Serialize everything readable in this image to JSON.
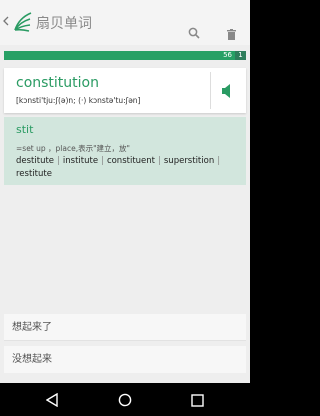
{
  "appbar": {
    "title": "扇贝单词",
    "back_icon": "chevron-left-icon",
    "logo_icon": "shanbay-leaf-logo",
    "search_icon": "search-icon",
    "delete_icon": "trash-icon"
  },
  "progress": {
    "count": "56",
    "remaining": "1",
    "fraction": 0.955,
    "colors": {
      "fill": "#27a065",
      "end": "#2e7d5b"
    }
  },
  "word": {
    "text": "constitution",
    "phonetic": "[kɔnsti'tju:ʃ(ə)n; (·) kɔnstə'tu:ʃən]",
    "sound_icon": "speaker-icon"
  },
  "root": {
    "text": "stit",
    "meaning": "=set up ，place,表示\"建立，放\"",
    "related_words": [
      "destitute",
      "institute",
      "constituent",
      "superstition",
      "restitute"
    ]
  },
  "buttons": {
    "remembered": "想起来了",
    "not_remembered": "没想起来"
  },
  "navbar": {
    "back_icon": "nav-back-icon",
    "home_icon": "nav-home-icon",
    "recents_icon": "nav-recents-icon"
  }
}
